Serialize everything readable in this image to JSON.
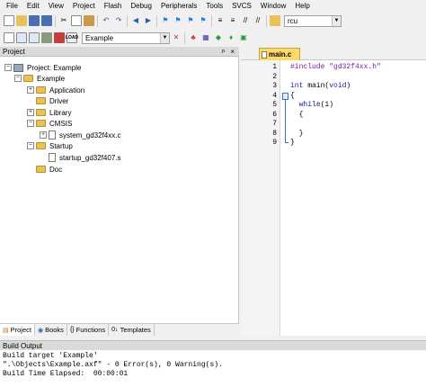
{
  "menu": [
    "File",
    "Edit",
    "View",
    "Project",
    "Flash",
    "Debug",
    "Peripherals",
    "Tools",
    "SVCS",
    "Window",
    "Help"
  ],
  "toolbar": {
    "find_combo_value": "rcu",
    "target_combo_value": "Example",
    "load_label": "LOAD"
  },
  "project_panel": {
    "title": "Project",
    "pin": "p",
    "close": "×",
    "tree": [
      {
        "label": "Project: Example"
      },
      {
        "label": "Example"
      },
      {
        "label": "Application"
      },
      {
        "label": "Driver"
      },
      {
        "label": "Library"
      },
      {
        "label": "CMSIS"
      },
      {
        "label": "system_gd32f4xx.c"
      },
      {
        "label": "Startup"
      },
      {
        "label": "startup_gd32f407.s"
      },
      {
        "label": "Doc"
      }
    ],
    "tabs": [
      "Project",
      "Books",
      "Functions",
      "Templates"
    ]
  },
  "editor": {
    "tab_label": "main.c",
    "line_numbers": [
      "1",
      "2",
      "3",
      "4",
      "5",
      "6",
      "7",
      "8",
      "9"
    ],
    "lines": [
      {
        "pp": "#include ",
        "str": "\"gd32f4xx.h\""
      },
      {
        "text": ""
      },
      {
        "kw": "int",
        "rest": " main(",
        "kw2": "void",
        "rest2": ")"
      },
      {
        "text": "{"
      },
      {
        "pre": "  ",
        "kw": "while",
        "rest": "(1)"
      },
      {
        "text": "  {"
      },
      {
        "text": ""
      },
      {
        "text": "  }"
      },
      {
        "text": "}"
      }
    ]
  },
  "build_output": {
    "title": "Build Output",
    "lines": [
      "Build target 'Example'",
      "\".\\Objects\\Example.axf\" - 0 Error(s), 0 Warning(s).",
      "Build Time Elapsed:  00:00:01"
    ]
  },
  "colors": {
    "tab_active": "#ffd86a",
    "keyword": "#1a1aa6",
    "string": "#7a1f9e",
    "fold_marker": "#2e6fd4"
  }
}
